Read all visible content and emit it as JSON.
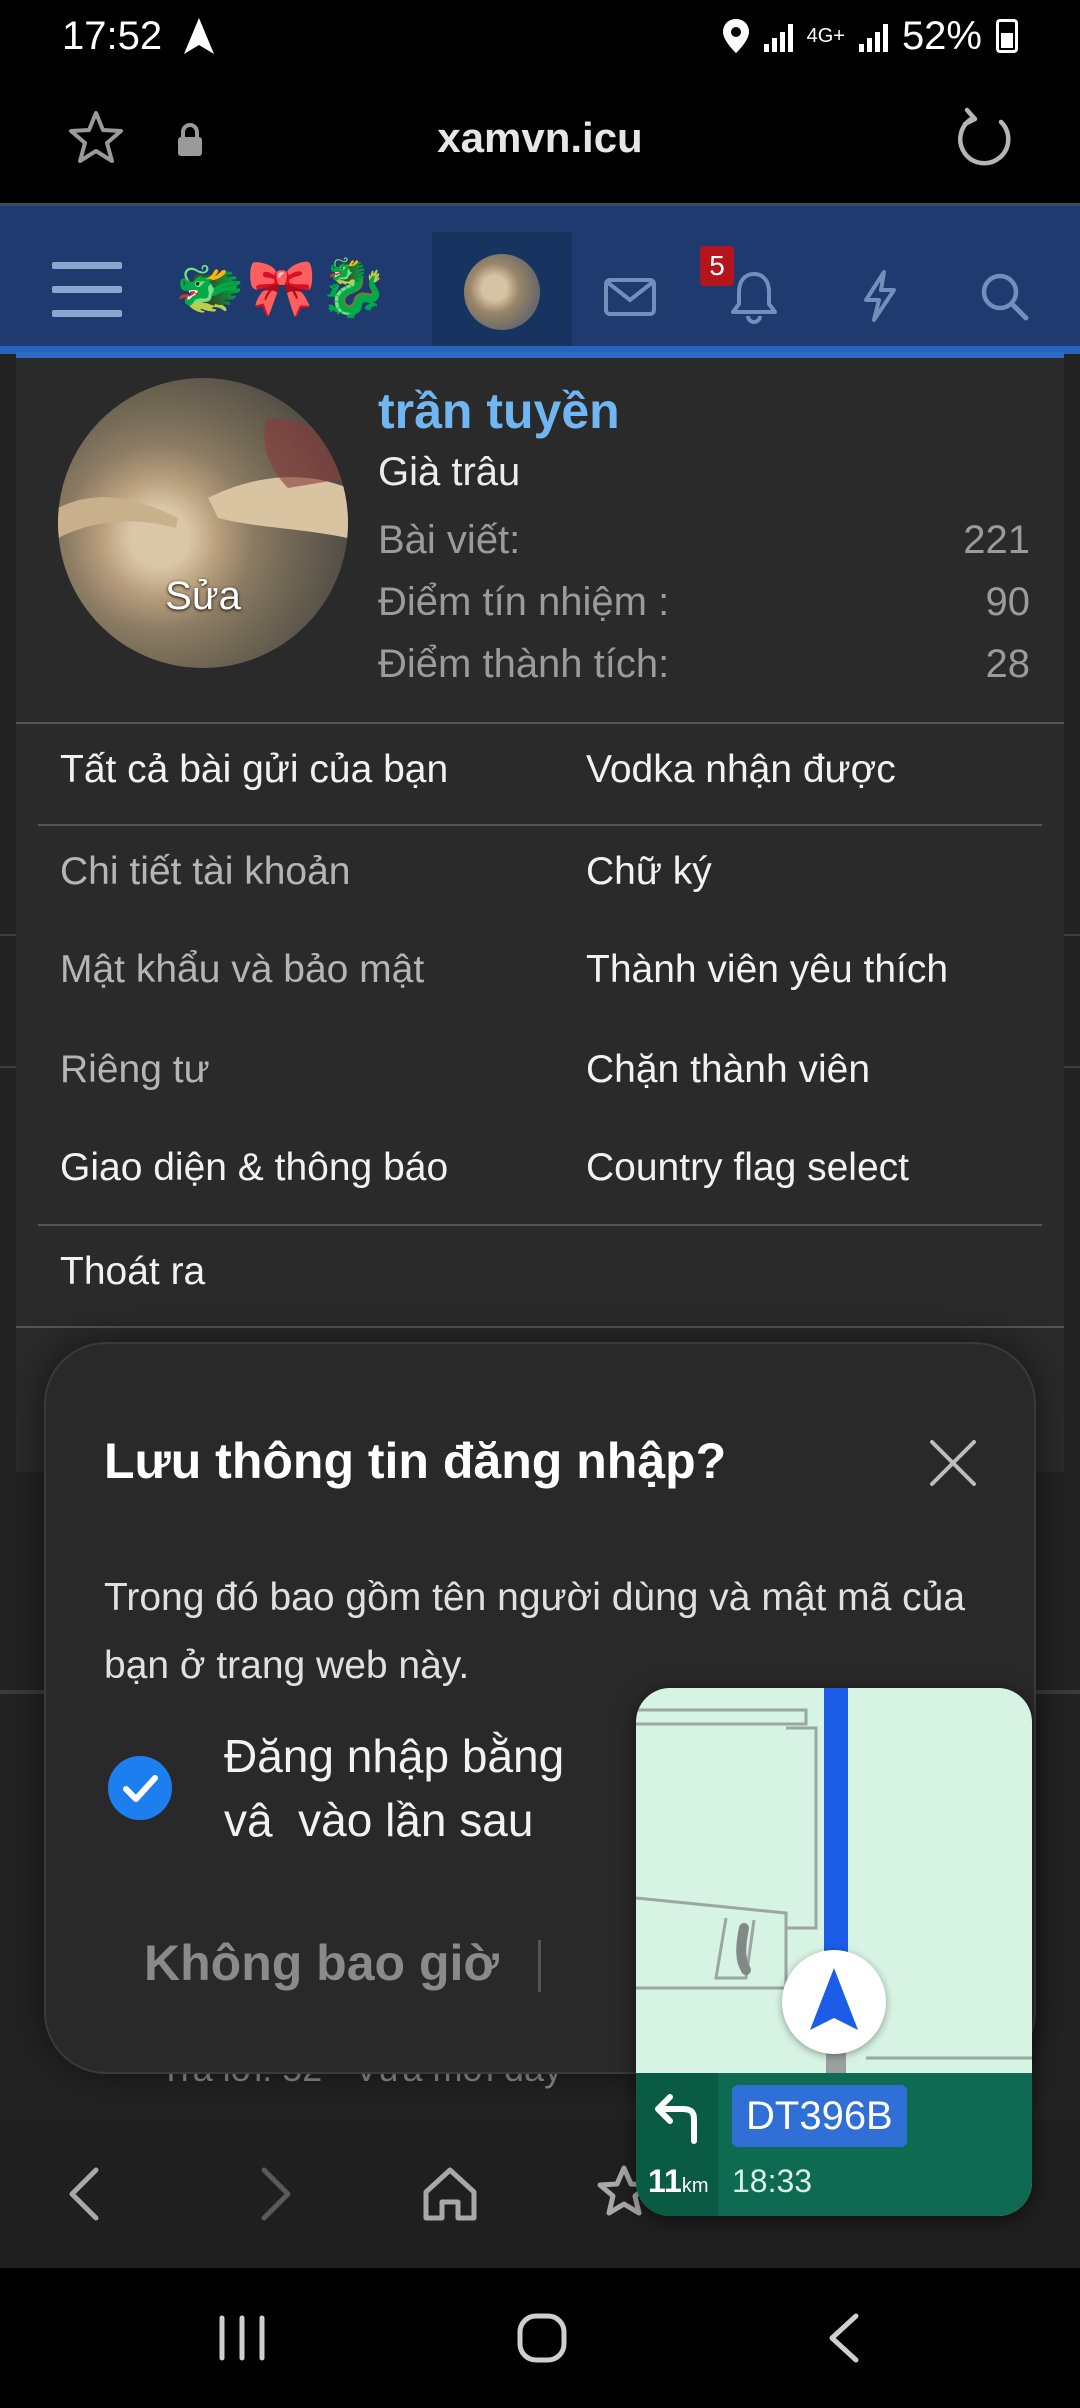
{
  "status_bar": {
    "time": "17:52",
    "network": "4G+",
    "battery": "52%"
  },
  "browser": {
    "domain": "xamvn.icu"
  },
  "forum_header": {
    "emojis": "🐲🎀🐉",
    "alerts_count": "5"
  },
  "profile": {
    "name": "trần tuyền",
    "title": "Già trâu",
    "edit_label": "Sửa",
    "stats": [
      {
        "label": "Bài viết:",
        "value": "221"
      },
      {
        "label": "Điểm tín nhiệm :",
        "value": "90"
      },
      {
        "label": "Điểm thành tích:",
        "value": "28"
      }
    ]
  },
  "menu": {
    "top_left": "Tất cả bài gửi của bạn",
    "top_right": "Vodka nhận được",
    "left_items": [
      "Chi tiết tài khoản",
      "Mật khẩu và bảo mật",
      "Riêng tư",
      "Giao diện & thông báo"
    ],
    "right_items": [
      "Chữ ký",
      "Thành viên yêu thích",
      "Chặn thành viên",
      "Country flag select"
    ],
    "logout": "Thoát ra"
  },
  "dialog": {
    "title": "Lưu thông tin đăng nhập?",
    "description": "Trong đó bao gồm tên người dùng và mật mã của bạn ở trang web này.",
    "checkbox_label": "Đăng nhập bằng vâ  vào lần sau",
    "never_button": "Không bao giờ"
  },
  "background": {
    "partial_text": "Trả lời: 52 · Vừa mới đây"
  },
  "navigation": {
    "road": "DT396B",
    "distance": "11",
    "distance_unit": "km",
    "eta": "18:33"
  }
}
